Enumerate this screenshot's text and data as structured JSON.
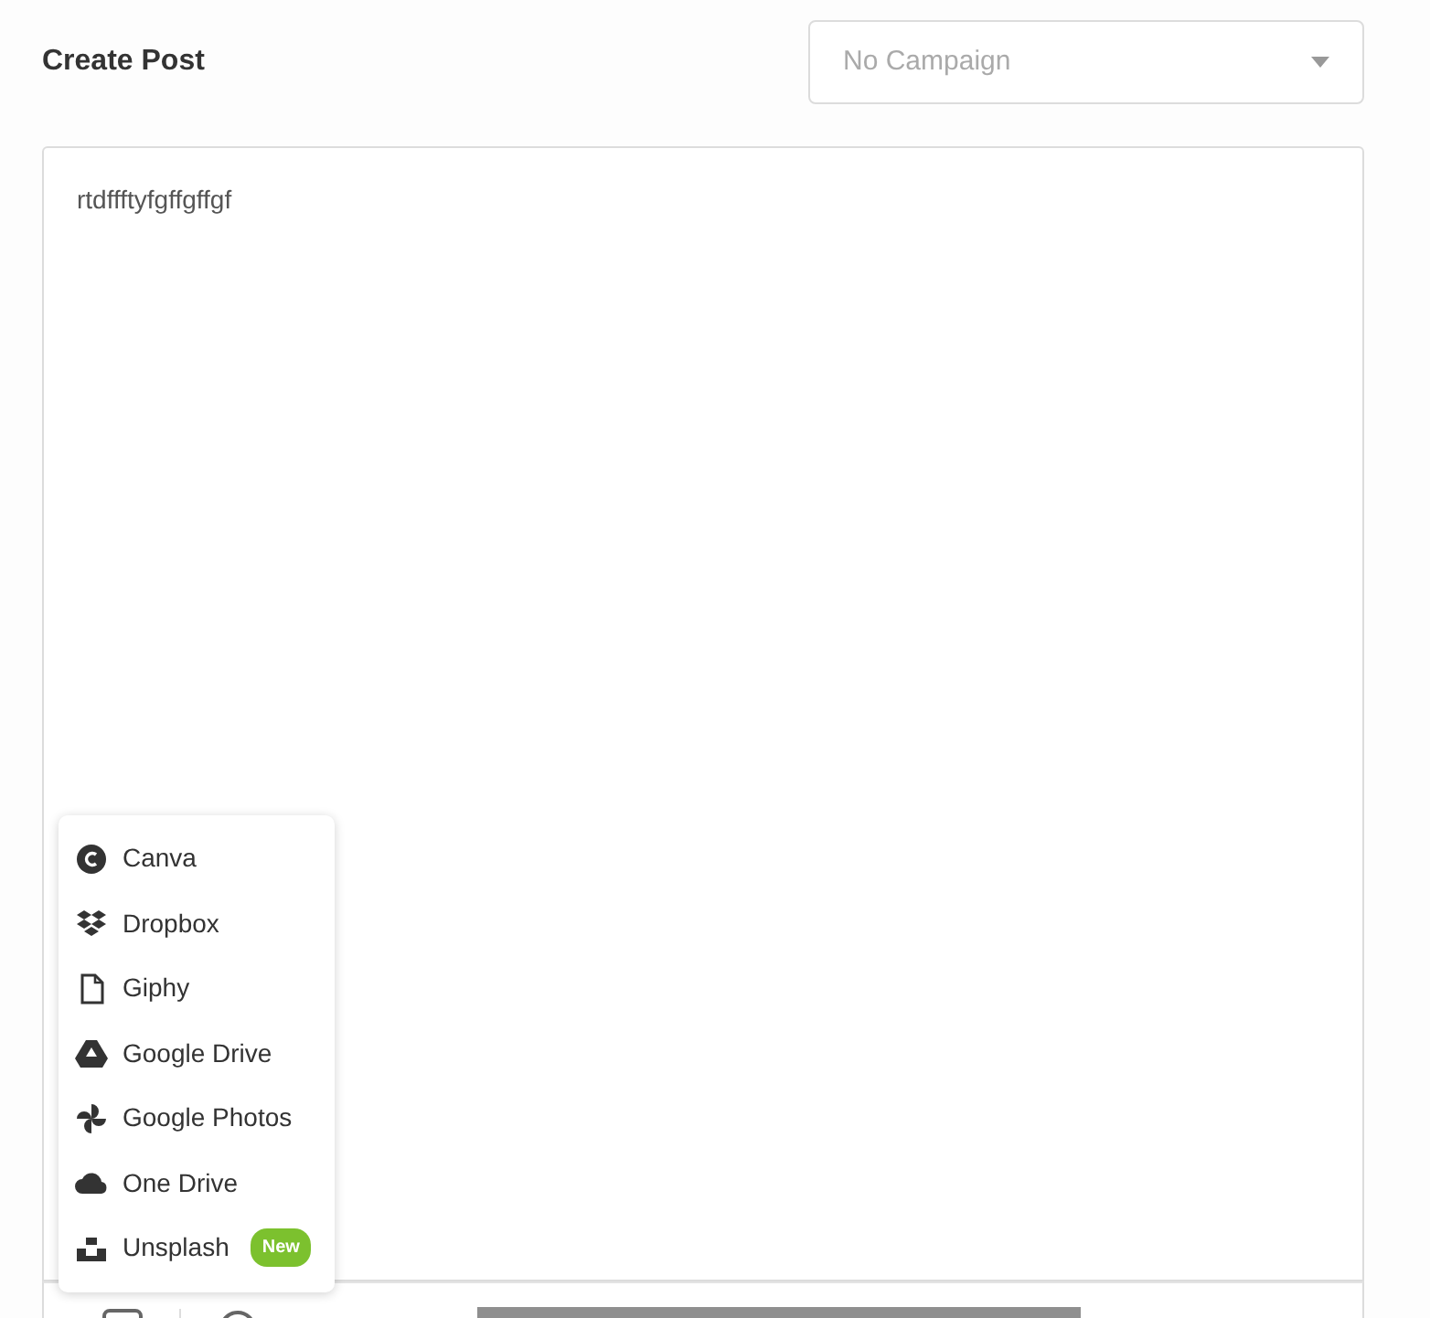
{
  "title": "Create Post",
  "campaign_select": {
    "placeholder": "No Campaign"
  },
  "editor": {
    "value": "rtdffftyfgffgffgf"
  },
  "media_menu": [
    {
      "label": "Canva"
    },
    {
      "label": "Dropbox"
    },
    {
      "label": "Giphy"
    },
    {
      "label": "Google Drive"
    },
    {
      "label": "Google Photos"
    },
    {
      "label": "One Drive"
    },
    {
      "label": "Unsplash",
      "badge": "New"
    }
  ]
}
